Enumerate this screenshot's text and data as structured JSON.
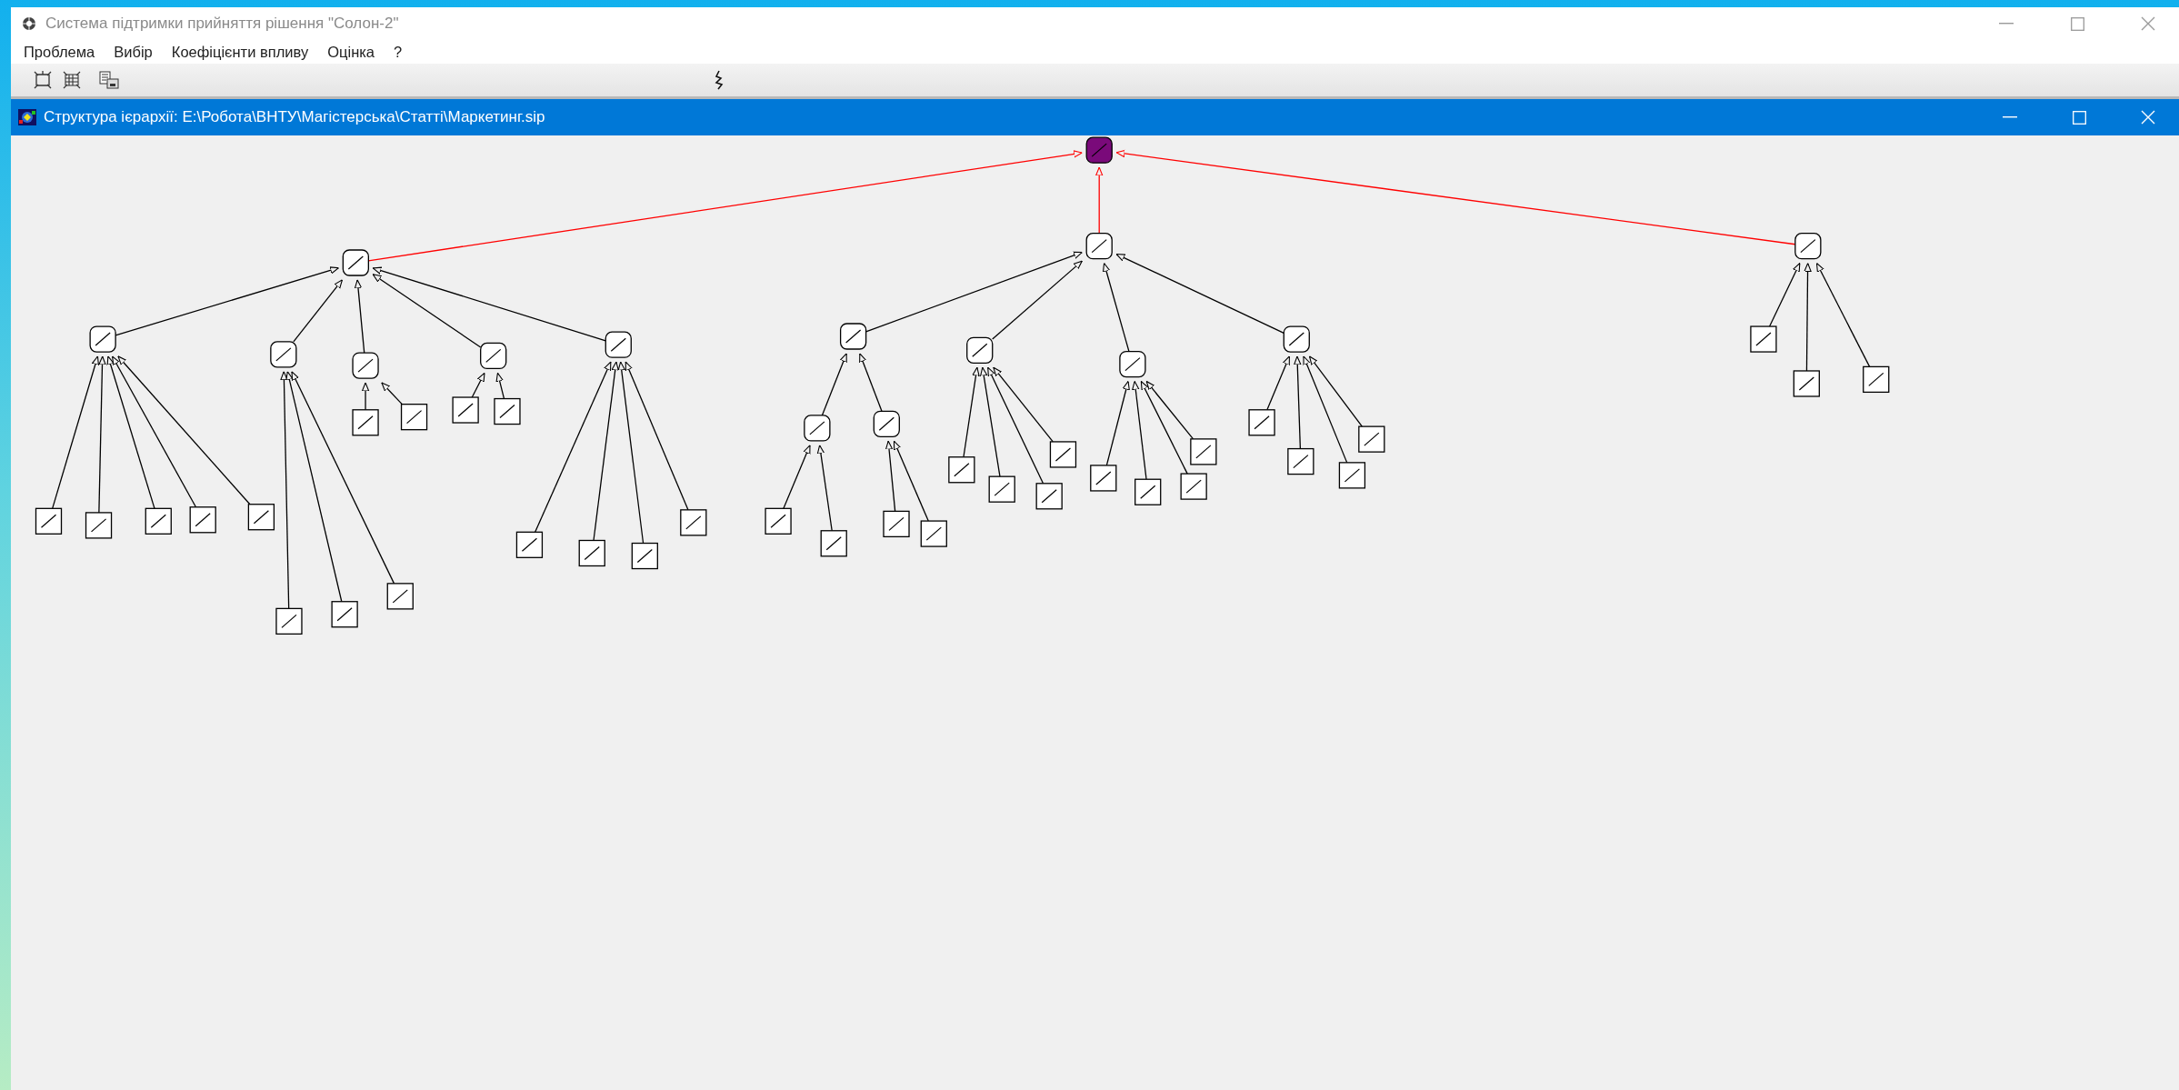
{
  "window": {
    "title": "Система підтримки прийняття рішення \"Солон-2\""
  },
  "menu": [
    {
      "label": "Проблема"
    },
    {
      "label": "Вибір"
    },
    {
      "label": "Коефіцієнти впливу"
    },
    {
      "label": "Оцінка"
    },
    {
      "label": "?"
    }
  ],
  "child_window": {
    "title": "Структура ієрархії: E:\\Робота\\ВНТУ\\Магістерська\\Статті\\Маркетинг.sip"
  },
  "hierarchy": {
    "selected": true,
    "children": [
      {
        "selected": false,
        "children": [
          {
            "selected": false,
            "children": [
              {
                "selected": false
              },
              {
                "selected": false
              },
              {
                "selected": false
              },
              {
                "selected": false
              },
              {
                "selected": false
              }
            ]
          },
          {
            "selected": false,
            "children": [
              {
                "selected": false
              },
              {
                "selected": false
              },
              {
                "selected": false
              }
            ]
          },
          {
            "selected": false,
            "children": [
              {
                "selected": false
              },
              {
                "selected": false
              }
            ]
          },
          {
            "selected": false,
            "children": [
              {
                "selected": false
              },
              {
                "selected": false
              }
            ]
          },
          {
            "selected": false,
            "children": [
              {
                "selected": false
              },
              {
                "selected": false
              },
              {
                "selected": false
              },
              {
                "selected": false
              }
            ]
          }
        ]
      },
      {
        "selected": false,
        "children": [
          {
            "selected": false,
            "children": [
              {
                "selected": false,
                "children": [
                  {
                    "selected": false
                  },
                  {
                    "selected": false
                  }
                ]
              },
              {
                "selected": false,
                "children": [
                  {
                    "selected": false
                  },
                  {
                    "selected": false
                  }
                ]
              }
            ]
          },
          {
            "selected": false,
            "children": [
              {
                "selected": false
              },
              {
                "selected": false
              },
              {
                "selected": false
              },
              {
                "selected": false
              }
            ]
          },
          {
            "selected": false,
            "children": [
              {
                "selected": false
              },
              {
                "selected": false
              },
              {
                "selected": false
              },
              {
                "selected": false
              }
            ]
          },
          {
            "selected": false,
            "children": [
              {
                "selected": false
              },
              {
                "selected": false
              },
              {
                "selected": false
              },
              {
                "selected": false
              }
            ]
          }
        ]
      },
      {
        "selected": false,
        "children": [
          {
            "selected": false
          },
          {
            "selected": false
          },
          {
            "selected": false
          }
        ]
      }
    ]
  }
}
